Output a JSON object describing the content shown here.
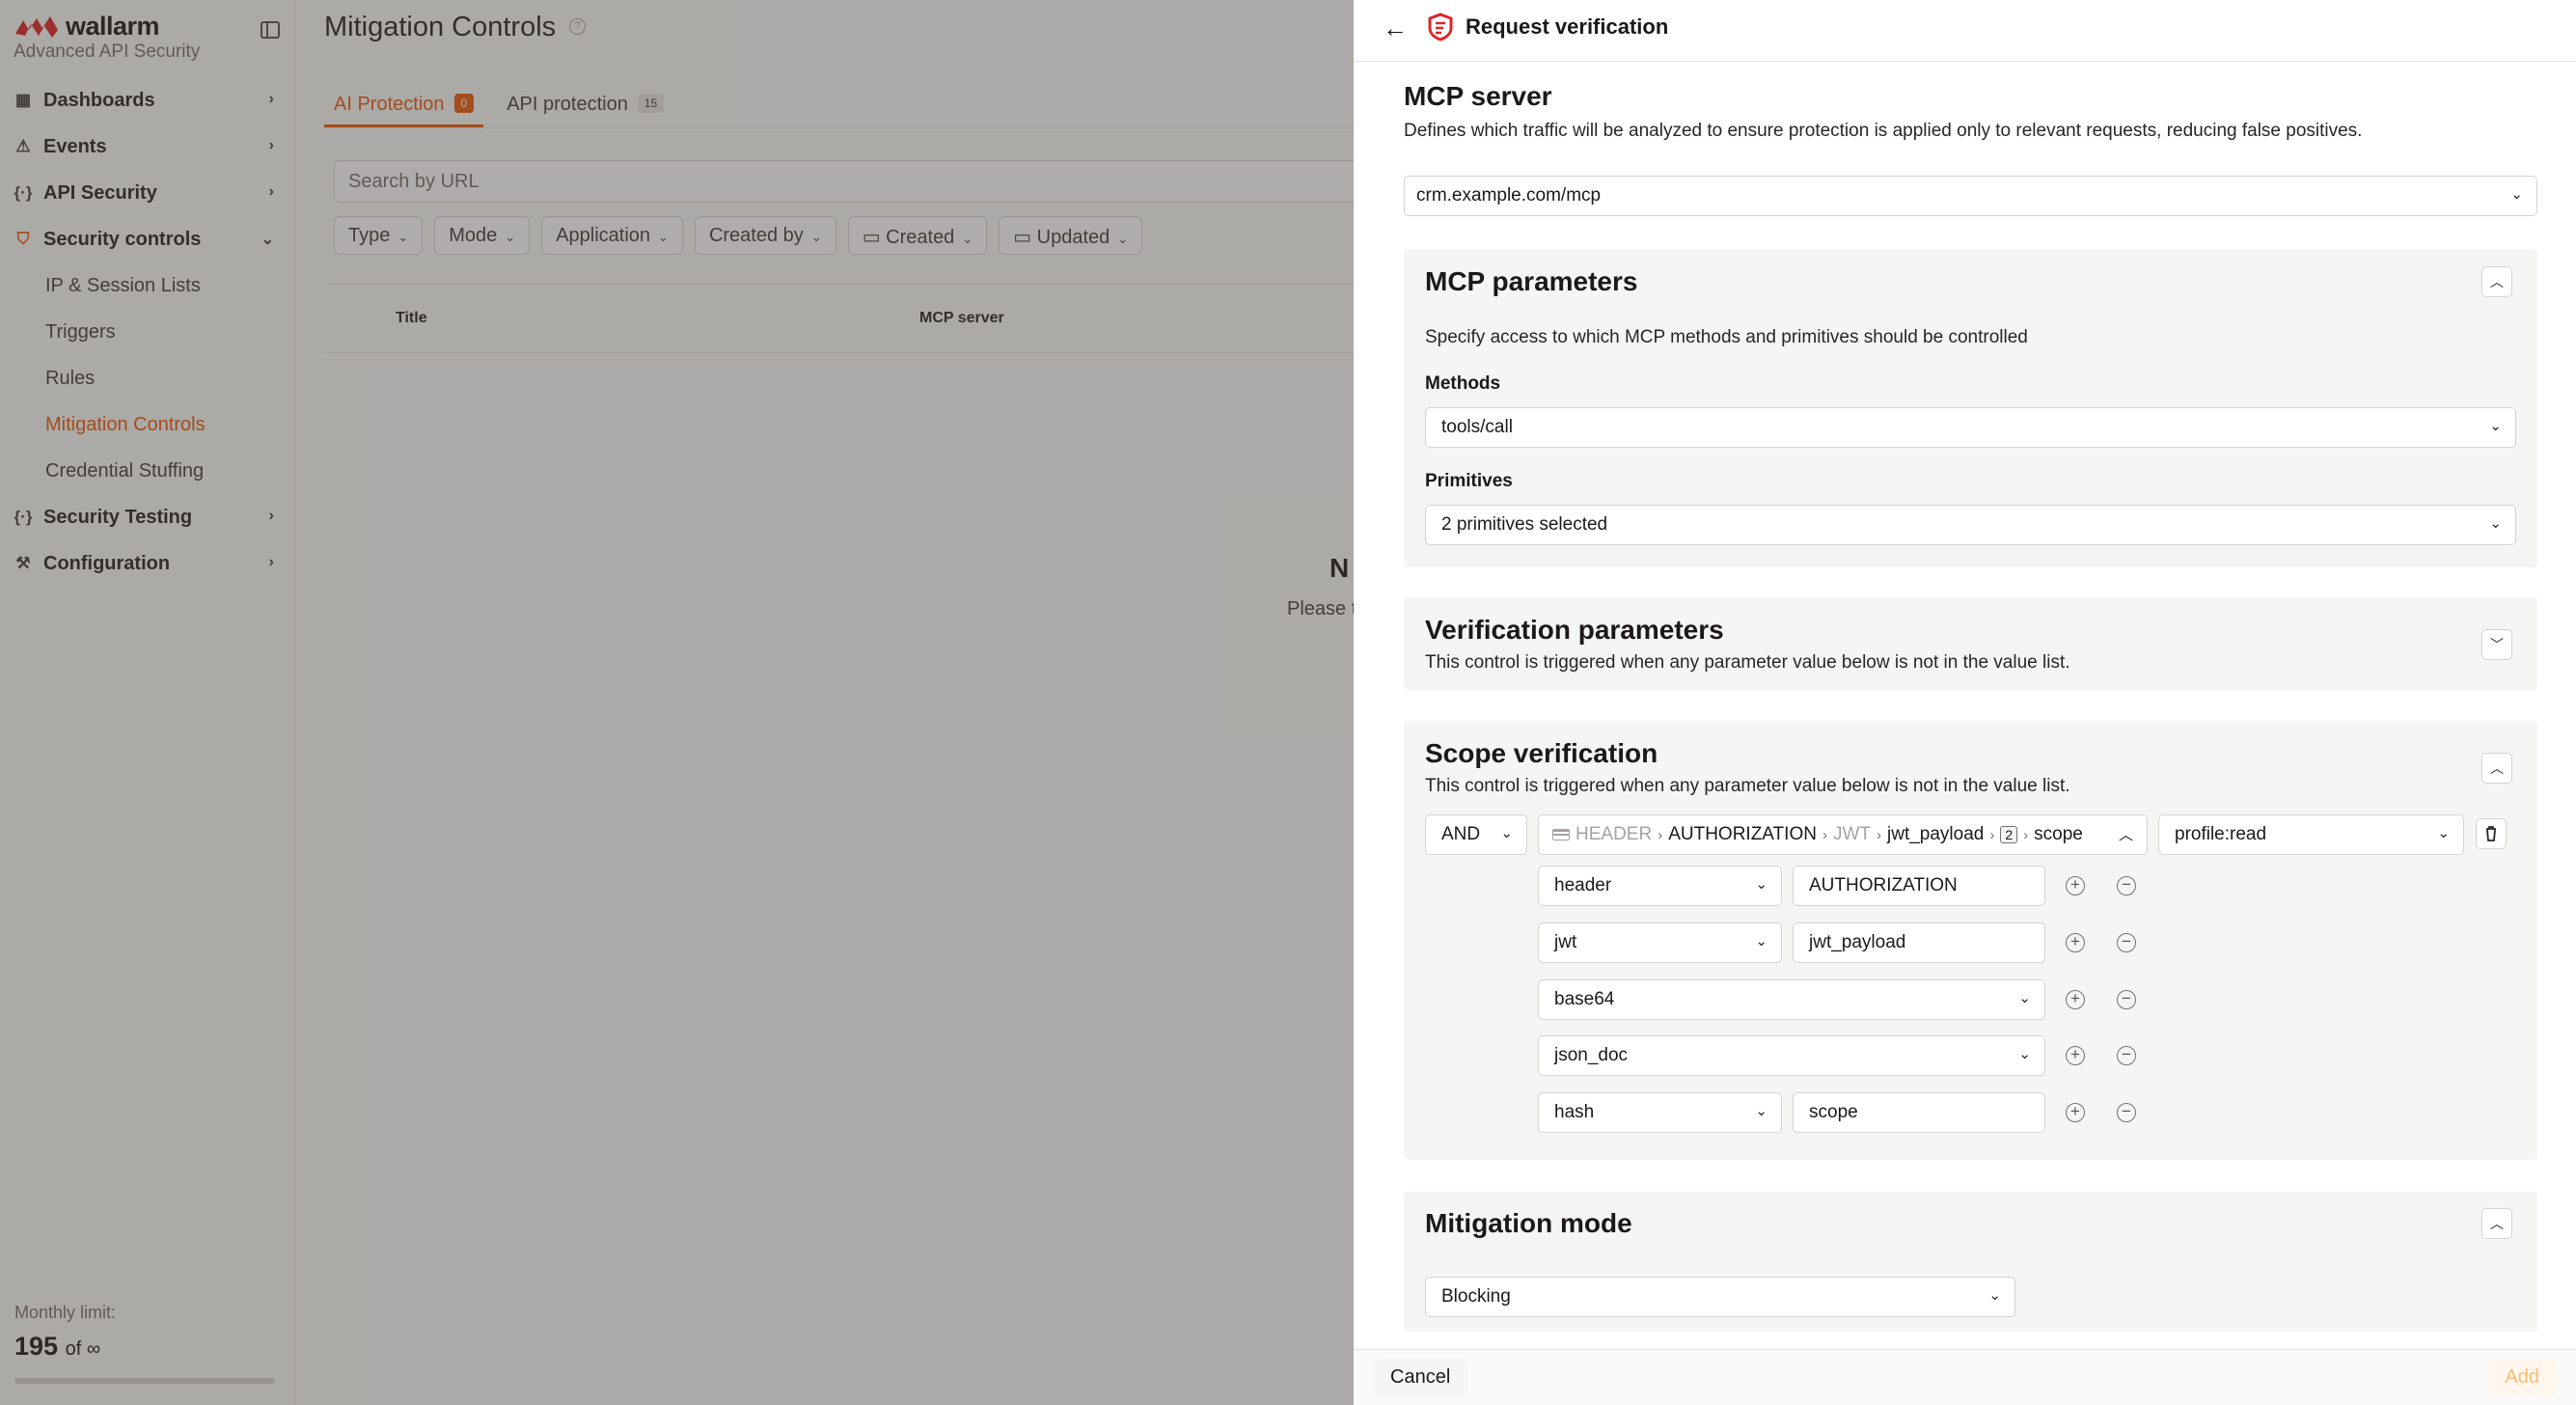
{
  "sidebar": {
    "brand": "wallarm",
    "subtitle": "Advanced API Security",
    "items": [
      {
        "label": "Dashboards",
        "icon": "grid-icon"
      },
      {
        "label": "Events",
        "icon": "warning-icon"
      },
      {
        "label": "API Security",
        "icon": "braces-icon"
      },
      {
        "label": "Security controls",
        "icon": "shield-icon"
      }
    ],
    "sub_items": [
      "IP & Session Lists",
      "Triggers",
      "Rules",
      "Mitigation Controls",
      "Credential Stuffing"
    ],
    "bottom_items": [
      {
        "label": "Security Testing",
        "icon": "braces-icon"
      },
      {
        "label": "Configuration",
        "icon": "tools-icon"
      }
    ],
    "limit_label": "Monthly limit:",
    "limit_value": "195",
    "limit_of": "of ∞"
  },
  "main": {
    "title": "Mitigation Controls",
    "tabs": [
      {
        "label": "AI Protection",
        "count": "0"
      },
      {
        "label": "API protection",
        "count": "15"
      }
    ],
    "search_placeholder": "Search by URL",
    "filters": [
      "Type",
      "Mode",
      "Application",
      "Created by",
      "Created",
      "Updated"
    ],
    "columns": [
      "Title",
      "MCP server"
    ],
    "empty_title": "N",
    "empty_sub": "Please t"
  },
  "drawer": {
    "title": "Request verification",
    "mcp_server": {
      "title": "MCP server",
      "desc": "Defines which traffic will be analyzed to ensure protection is applied only to relevant requests, reducing false positives.",
      "value": "crm.example.com/mcp"
    },
    "mcp_params": {
      "title": "MCP parameters",
      "desc": "Specify access to which MCP methods and primitives should be controlled",
      "methods_label": "Methods",
      "methods_value": "tools/call",
      "primitives_label": "Primitives",
      "primitives_value": "2 primitives selected"
    },
    "verification_params": {
      "title": "Verification parameters",
      "desc": "This control is triggered when any parameter value below is not in the value list."
    },
    "scope_verification": {
      "title": "Scope verification",
      "desc": "This control is triggered when any parameter value below is not in the value list.",
      "operator": "AND",
      "path": {
        "p1": "HEADER",
        "p2": "AUTHORIZATION",
        "p3": "JWT",
        "p4": "jwt_payload",
        "p5": "2",
        "p6": "scope"
      },
      "value": "profile:read",
      "rows": [
        {
          "type": "header",
          "value": "AUTHORIZATION"
        },
        {
          "type": "jwt",
          "value": "jwt_payload"
        },
        {
          "type": "base64",
          "value": ""
        },
        {
          "type": "json_doc",
          "value": ""
        },
        {
          "type": "hash",
          "value": "scope"
        }
      ]
    },
    "mitigation_mode": {
      "title": "Mitigation mode",
      "value": "Blocking"
    }
  },
  "footer": {
    "cancel": "Cancel",
    "add": "Add"
  },
  "colors": {
    "accent": "#ea580c",
    "text": "#1c1917",
    "panel": "#f5f5f4"
  }
}
